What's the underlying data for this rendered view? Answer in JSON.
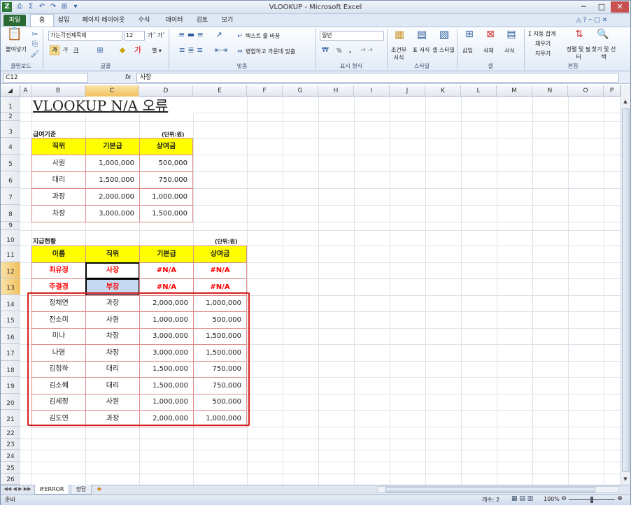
{
  "window": {
    "title": "VLOOKUP - Microsoft Excel",
    "min": "─",
    "max": "□",
    "close": "✕"
  },
  "quick_access": [
    "Z",
    "⎙",
    "Σ",
    "↶",
    "↷",
    "⊞",
    "▾"
  ],
  "tabs": [
    "파일",
    "홈",
    "삽입",
    "페이지 레이아웃",
    "수식",
    "데이터",
    "검토",
    "보기"
  ],
  "ribbon": {
    "clipboard": {
      "paste": "붙여넣기",
      "label": "클립보드"
    },
    "font": {
      "name": "가는각진제목체",
      "size": "12",
      "label": "글꼴",
      "bold": "가",
      "italic": "가",
      "underline": "가"
    },
    "align": {
      "wrap": "텍스트 줄 바꿈",
      "merge": "병합하고 가운데 맞춤",
      "label": "맞춤"
    },
    "number": {
      "format": "일반",
      "label": "표시 형식",
      "pct": "%",
      "comma": ","
    },
    "styles": {
      "cond": "조건부 서식",
      "table": "표 서식",
      "cell": "셀 스타일",
      "label": "스타일"
    },
    "cells": {
      "insert": "삽입",
      "delete": "삭제",
      "format": "서식",
      "label": "셀"
    },
    "edit": {
      "autosum": "Σ 자동 합계",
      "fill": "채우기",
      "clear": "지우기",
      "sort": "정렬 및 필터",
      "find": "찾기 및 선택",
      "label": "편집"
    }
  },
  "formula_bar": {
    "name_box": "C12",
    "fx": "fx",
    "value": "사장"
  },
  "columns": [
    "A",
    "B",
    "C",
    "D",
    "E",
    "F",
    "G",
    "H",
    "I",
    "J",
    "K",
    "L",
    "M",
    "N",
    "O",
    "P"
  ],
  "rows": [
    "1",
    "2",
    "3",
    "4",
    "5",
    "6",
    "7",
    "8",
    "9",
    "10",
    "11",
    "12",
    "13",
    "14",
    "15",
    "16",
    "17",
    "18",
    "19",
    "20",
    "21",
    "22",
    "23",
    "24",
    "25",
    "26"
  ],
  "sheet": {
    "title": "VLOOKUP N/A 오류",
    "t1_label": "급여기준",
    "t1_unit": "(단위:원)",
    "t1_headers": [
      "직위",
      "기본급",
      "상여금"
    ],
    "t1_rows": [
      [
        "사원",
        "1,000,000",
        "500,000"
      ],
      [
        "대리",
        "1,500,000",
        "750,000"
      ],
      [
        "과장",
        "2,000,000",
        "1,000,000"
      ],
      [
        "차장",
        "3,000,000",
        "1,500,000"
      ]
    ],
    "t2_label": "지급현황",
    "t2_unit": "(단위:원)",
    "t2_headers": [
      "이름",
      "직위",
      "기본급",
      "상여금"
    ],
    "t2_rows": [
      [
        "최유정",
        "사장",
        "#N/A",
        "#N/A"
      ],
      [
        "주결경",
        "부장",
        "#N/A",
        "#N/A"
      ],
      [
        "정채연",
        "과장",
        "2,000,000",
        "1,000,000"
      ],
      [
        "전소미",
        "사원",
        "1,000,000",
        "500,000"
      ],
      [
        "미나",
        "차장",
        "3,000,000",
        "1,500,000"
      ],
      [
        "나영",
        "차장",
        "3,000,000",
        "1,500,000"
      ],
      [
        "김청하",
        "대리",
        "1,500,000",
        "750,000"
      ],
      [
        "김소혜",
        "대리",
        "1,500,000",
        "750,000"
      ],
      [
        "김세정",
        "사원",
        "1,000,000",
        "500,000"
      ],
      [
        "김도연",
        "과장",
        "2,000,000",
        "1,000,000"
      ]
    ]
  },
  "sheet_tabs": [
    "IFERROR",
    "정답"
  ],
  "status": {
    "ready": "준비",
    "count": "개수: 2",
    "zoom": "100%"
  }
}
